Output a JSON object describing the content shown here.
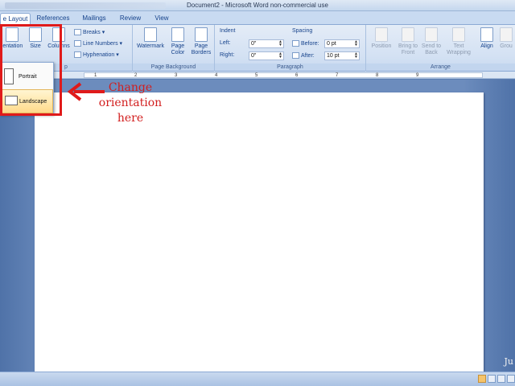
{
  "window": {
    "title": "Document2 - Microsoft Word non-commercial use"
  },
  "tabs": [
    {
      "label": "e Layout",
      "active": true
    },
    {
      "label": "References",
      "active": false
    },
    {
      "label": "Mailings",
      "active": false
    },
    {
      "label": "Review",
      "active": false
    },
    {
      "label": "View",
      "active": false
    }
  ],
  "ribbon": {
    "page_setup": {
      "label": "p",
      "orientation_label": "ientation",
      "size_label": "Size",
      "columns_label": "Columns",
      "breaks_label": "Breaks",
      "line_numbers_label": "Line Numbers",
      "hyphenation_label": "Hyphenation"
    },
    "page_background": {
      "label": "Page Background",
      "watermark_label": "Watermark",
      "page_color_line1": "Page",
      "page_color_line2": "Color",
      "page_borders_line1": "Page",
      "page_borders_line2": "Borders"
    },
    "paragraph": {
      "label": "Paragraph",
      "indent_title": "Indent",
      "left_label": "Left:",
      "left_value": "0\"",
      "right_label": "Right:",
      "right_value": "0\"",
      "spacing_title": "Spacing",
      "before_label": "Before:",
      "before_value": "0 pt",
      "after_label": "After:",
      "after_value": "10 pt"
    },
    "arrange": {
      "label": "Arrange",
      "position_label": "Position",
      "bring_front_line1": "Bring to",
      "bring_front_line2": "Front",
      "send_back_line1": "Send to",
      "send_back_line2": "Back",
      "text_wrap_line1": "Text",
      "text_wrap_line2": "Wrapping",
      "align_label": "Align",
      "group_label": "Grou"
    }
  },
  "orientation_menu": {
    "portrait_label": "Portrait",
    "landscape_label": "Landscape"
  },
  "ruler": {
    "numbers": [
      "1",
      "2",
      "3",
      "4",
      "5",
      "6",
      "7",
      "8",
      "9"
    ]
  },
  "annotation": {
    "text": "Change\norientation\nhere",
    "color": "#d21e1e"
  },
  "watermark_text": "Ju",
  "colors": {
    "accent": "#15428b",
    "annotation_red": "#e01a1a",
    "highlight": "#ffd98a"
  }
}
